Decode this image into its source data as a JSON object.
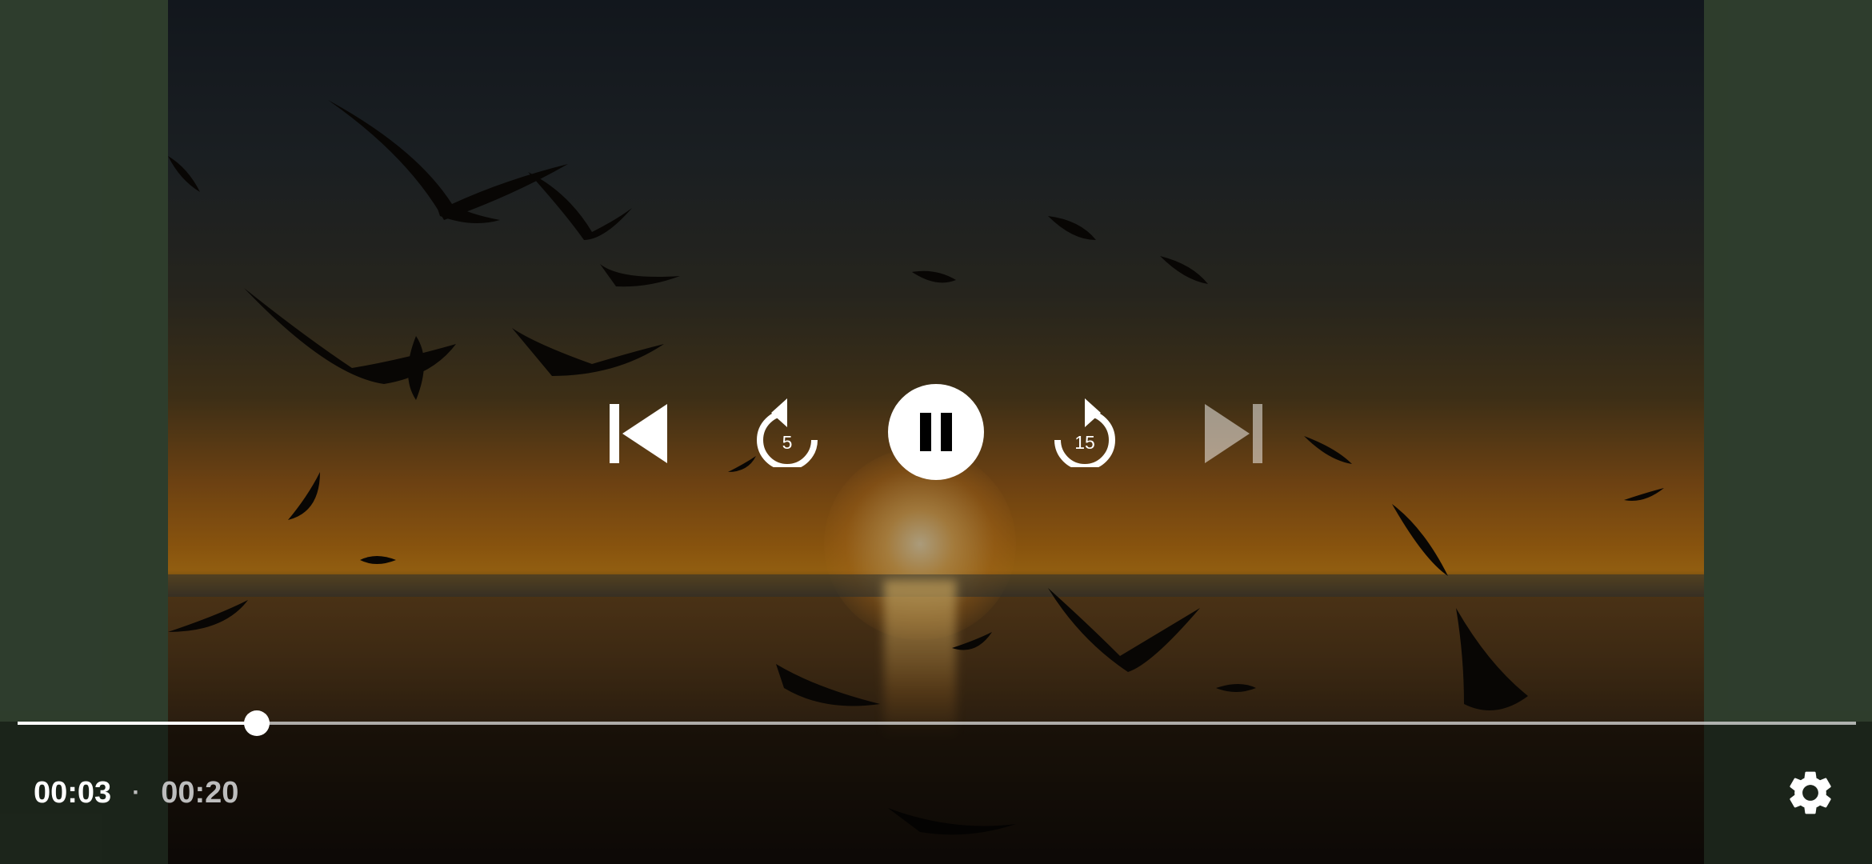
{
  "player": {
    "current_time": "00:03",
    "separator": "·",
    "total_time": "00:20",
    "progress": 0.13,
    "is_playing": true
  },
  "controls": {
    "rewind_seconds": "5",
    "forward_seconds": "15",
    "next_enabled": false
  },
  "icons": {
    "previous": "skip-previous-icon",
    "rewind": "replay-5-icon",
    "play_pause": "pause-icon",
    "forward": "forward-15-icon",
    "next": "skip-next-icon",
    "settings": "gear-icon"
  },
  "colors": {
    "side_background": "#445a42",
    "control_white": "#ffffff",
    "secondary_text": "#bdbdbd"
  }
}
